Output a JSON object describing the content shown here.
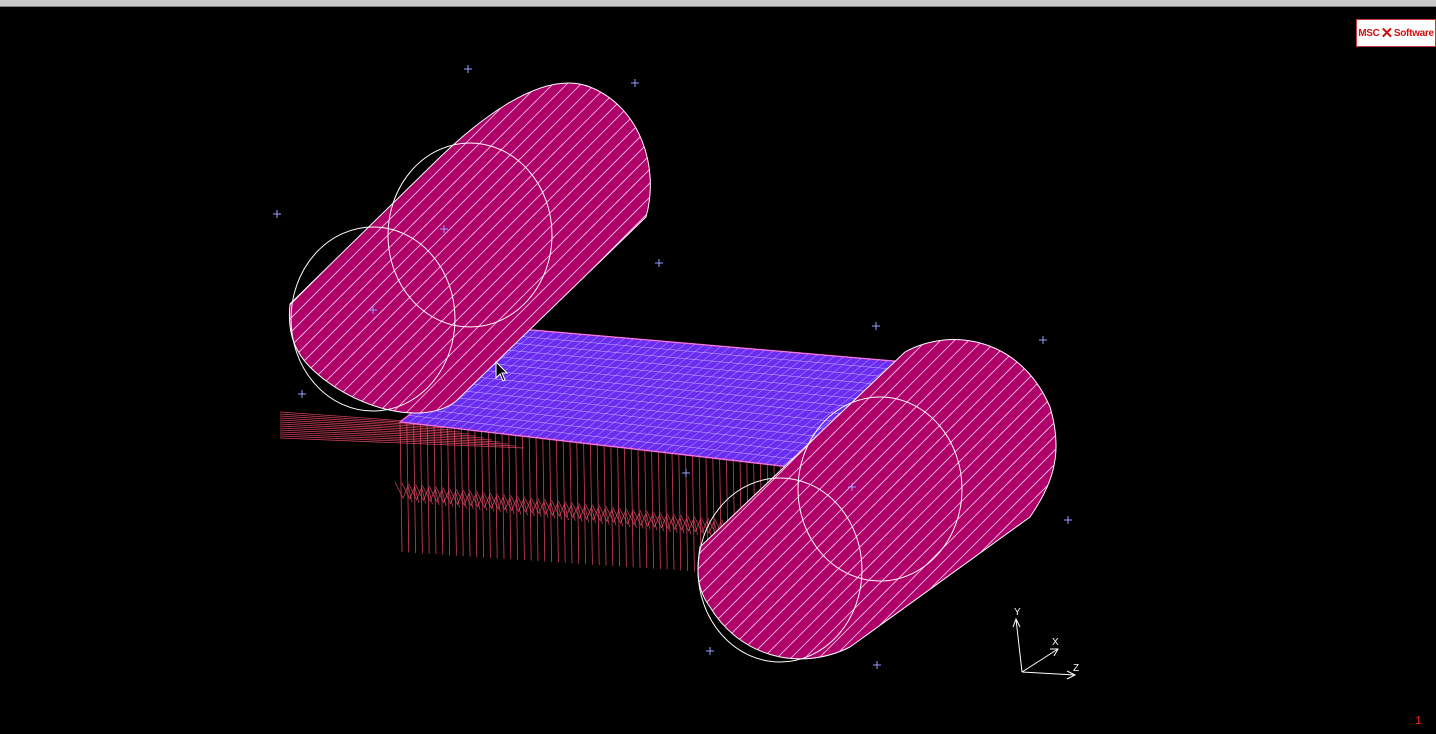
{
  "window": {
    "title": ""
  },
  "viewport": {
    "background": "#000000",
    "number": "1"
  },
  "logo": {
    "brand_left": "MSC",
    "brand_right": "Software",
    "color": "#d01010"
  },
  "triad": {
    "y_label": "Y",
    "x_label": "X",
    "z_label": "Z"
  },
  "model": {
    "roller_color": "#b0006a",
    "roller_line_color": "#ffd0e8",
    "sheet_color": "#7a3cff",
    "sheet_mesh_color": "#ffffff",
    "load_arrow_color": "#ff5070",
    "node_marker_color": "#9aa0ff"
  },
  "cursor": {
    "icon": "arrow-cursor-icon"
  }
}
